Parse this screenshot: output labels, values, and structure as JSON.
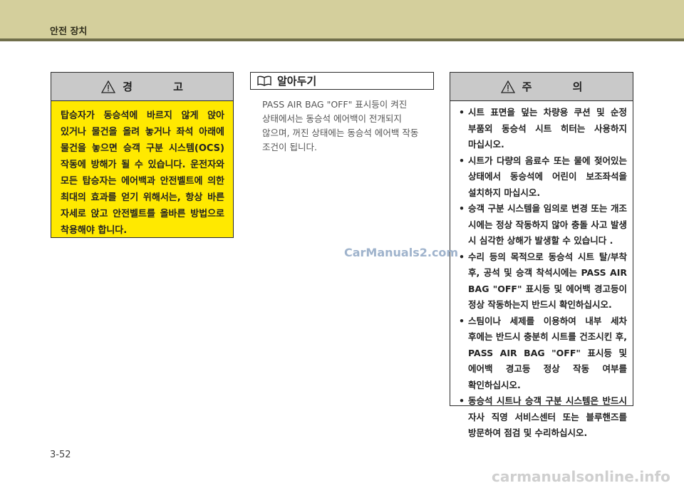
{
  "header": {
    "section_title": "안전 장치"
  },
  "warning": {
    "icon": "warning-triangle-icon",
    "title": "경 고",
    "body": "탑승자가 동승석에 바르지 않게 앉아 있거나 물건을 올려 놓거나 좌석 아래에 물건을 놓으면 승객 구분 시스템(OCS) 작동에 방해가 될 수 있습니다. 운전자와 모든 탑승자는 에어백과 안전벨트에 의한 최대의 효과를 얻기 위해서는, 항상 바른 자세로 앉고 안전벨트를 올바른 방법으로 착용해야 합니다."
  },
  "info": {
    "icon": "open-book-icon",
    "title": "알아두기",
    "body": "PASS AIR BAG \"OFF\" 표시등이 켜진 상태에서는 동승석 에어백이 전개되지 않으며, 꺼진 상태에는 동승석 에어백 작동 조건이 됩니다."
  },
  "caution": {
    "icon": "warning-triangle-icon",
    "title": "주 의",
    "bullet": "•",
    "items": [
      "시트 표면을 덮는 차량용 쿠션 및 순정 부품외 동승석 시트 히터는 사용하지 마십시오.",
      "시트가 다량의 음료수 또는 물에 젖어있는 상태에서 동승석에 어린이 보조좌석을 설치하지 마십시오.",
      "승객 구분 시스템을 임의로 변경 또는 개조 시에는 정상 작동하지 않아 충돌 사고 발생 시 심각한 상해가 발생할 수 있습니다 .",
      "수리 등의 목적으로 동승석 시트 탈/부착 후, 공석 및 승객 착석시에는 PASS AIR BAG \"OFF\" 표시등 및 에어백 경고등이 정상 작동하는지 반드시 확인하십시오.",
      "스팀이나 세제를 이용하여 내부 세차 후에는 반드시 충분히 시트를 건조시킨 후, PASS AIR BAG \"OFF\" 표시등 및 에어백 경고등 정상 작동 여부를 확인하십시오.",
      "동승석 시트나 승객 구분 시스템은 반드시 자사 직영 서비스센터 또는 블루핸즈를 방문하여 점검 및 수리하십시오."
    ]
  },
  "watermark": "CarManuals2.com",
  "footer": {
    "page_number": "3-52",
    "site": "carmanualsonline.info"
  },
  "colors": {
    "header_band": "#d4cf9c",
    "header_line": "#716f4b",
    "warning_fill": "#ffe900",
    "box_head": "#c9c9c9"
  }
}
